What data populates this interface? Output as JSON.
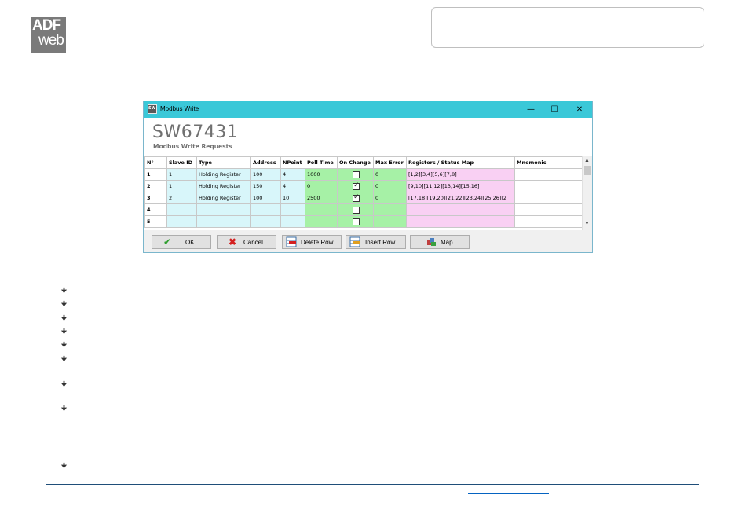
{
  "logo": {
    "top": "ADF",
    "bottom": "web"
  },
  "window": {
    "title": "Modbus Write",
    "controls": {
      "minimize": "—",
      "maximize": "☐",
      "close": "✕"
    }
  },
  "header": {
    "title": "SW67431",
    "subtitle": "Modbus Write Requests"
  },
  "grid": {
    "columns": [
      "N°",
      "Slave ID",
      "Type",
      "Address",
      "NPoint",
      "Poll Time",
      "On Change",
      "Max Error",
      "Registers / Status Map",
      "Mnemonic"
    ],
    "rows": [
      {
        "n": "1",
        "slave_id": "1",
        "type": "Holding Register",
        "address": "100",
        "npoint": "4",
        "poll_time": "1000",
        "on_change": false,
        "max_error": "0",
        "map": "[1,2][3,4][5,6][7,8]",
        "mnemonic": ""
      },
      {
        "n": "2",
        "slave_id": "1",
        "type": "Holding Register",
        "address": "150",
        "npoint": "4",
        "poll_time": "0",
        "on_change": true,
        "max_error": "0",
        "map": "[9,10][11,12][13,14][15,16]",
        "mnemonic": ""
      },
      {
        "n": "3",
        "slave_id": "2",
        "type": "Holding Register",
        "address": "100",
        "npoint": "10",
        "poll_time": "2500",
        "on_change": true,
        "max_error": "0",
        "map": "[17,18][19,20][21,22][23,24][25,26][2",
        "mnemonic": ""
      },
      {
        "n": "4",
        "slave_id": "",
        "type": "",
        "address": "",
        "npoint": "",
        "poll_time": "",
        "on_change": false,
        "max_error": "",
        "map": "",
        "mnemonic": ""
      },
      {
        "n": "5",
        "slave_id": "",
        "type": "",
        "address": "",
        "npoint": "",
        "poll_time": "",
        "on_change": false,
        "max_error": "",
        "map": "",
        "mnemonic": ""
      }
    ]
  },
  "buttons": {
    "ok": "OK",
    "cancel": "Cancel",
    "delete_row": "Delete Row",
    "insert_row": "Insert Row",
    "map": "Map"
  },
  "colors": {
    "titlebar": "#3ac8d8",
    "cyan_cells": "#d8f6fa",
    "green_cells": "#a6f1a6",
    "pink_cells": "#f9d0f3"
  },
  "icons": {
    "ok": "check-icon",
    "cancel": "red-x-icon",
    "delete_row": "delete-row-icon",
    "insert_row": "insert-row-icon",
    "map": "map-icon",
    "bullet": "bullet-icon"
  }
}
